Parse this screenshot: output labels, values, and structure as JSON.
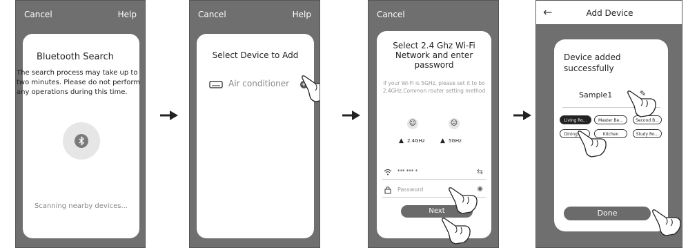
{
  "screen1": {
    "cancel": "Cancel",
    "help": "Help",
    "title": "Bluetooth Search",
    "message": "The search process may take up to two minutes. Please do not perform any operations during this time.",
    "status": "Scanning nearby devices...",
    "bluetooth_icon": "bluetooth-icon"
  },
  "screen2": {
    "cancel": "Cancel",
    "help": "Help",
    "title": "Select Device to Add",
    "device": "Air conditioner"
  },
  "screen3": {
    "cancel": "Cancel",
    "title": "Select 2.4 Ghz Wi-Fi Network and enter password",
    "hint": "If your Wi-Fi is 5GHz, please set it to bo 2.4GHz.Common router setting method",
    "opt_24": "2.4GHz",
    "opt_5": "5GHz",
    "wifi_value": "*** *** *",
    "password_placeholder": "Password",
    "next": "Next"
  },
  "screen4": {
    "title": "Add Device",
    "success": "Device added successfully",
    "device_name": "Sample1",
    "rooms": [
      "Living Ro...",
      "Master Be...",
      "Second B...",
      "Dining R...",
      "Kitchen",
      "Study Ro..."
    ],
    "selected_room": "Living Ro...",
    "done": "Done"
  },
  "colors": {
    "screen_bg": "#6f6f6f",
    "card_bg": "#ffffff",
    "button_bg": "#6b6b6b",
    "selected_tag": "#222222"
  }
}
